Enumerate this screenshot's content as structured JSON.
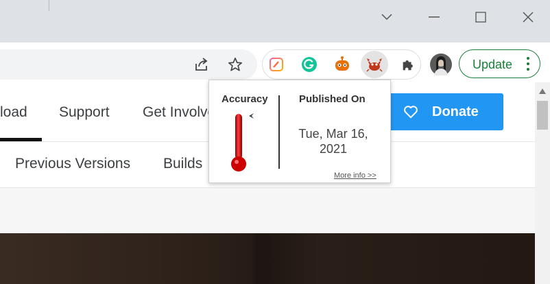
{
  "browser": {
    "window_controls": {
      "dropdown_icon": "chevron-down-icon",
      "minimize_icon": "minimize-icon",
      "maximize_icon": "maximize-icon",
      "close_icon": "close-icon"
    },
    "toolbar": {
      "share_icon": "share-icon",
      "bookmark_icon": "star-icon",
      "extensions": [
        "edit-extension-icon",
        "grammarly-icon",
        "robot-extension-icon",
        "crab-extension-icon"
      ],
      "puzzle_icon": "puzzle-icon",
      "update_label": "Update",
      "update_color": "#188038"
    }
  },
  "page": {
    "nav": [
      "load",
      "Support",
      "Get Involve"
    ],
    "subnav": [
      "Previous Versions",
      "Builds"
    ],
    "donate_label": "Donate",
    "accent_color": "#2196f3"
  },
  "popup": {
    "accuracy_label": "Accuracy",
    "published_label": "Published On",
    "date_line1": "Tue, Mar 16,",
    "date_line2": "2021",
    "more_info": "More info >>",
    "thermometer_color": "#cc0000"
  }
}
